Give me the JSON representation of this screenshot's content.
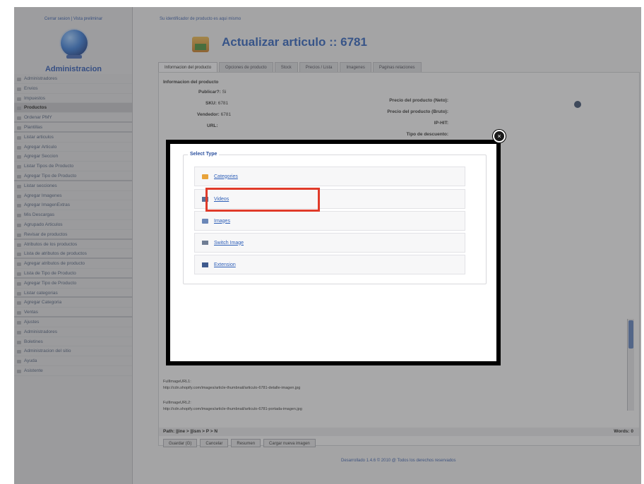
{
  "header": {
    "title": "Actualizar articulo :: 6781",
    "breadcrumb": "Su identificador de producto es aqui mismo"
  },
  "sidebar": {
    "top_links": "Cerrar sesion | Vista preliminar",
    "title": "Administracion",
    "items": [
      {
        "label": "Administradores"
      },
      {
        "label": "Envios"
      },
      {
        "label": "Impuestos"
      },
      {
        "label": "Productos",
        "active": true
      },
      {
        "label": "Ordenar PMY"
      },
      {
        "label": "Plantillas"
      },
      {
        "label": "Listar articulos"
      },
      {
        "label": "Agregar Articulo"
      },
      {
        "label": "Agregar Seccion"
      },
      {
        "label": "Listar Tipos de Producto"
      },
      {
        "label": "Agregar Tipo de Producto"
      },
      {
        "label": "Listar secciones"
      },
      {
        "label": "Agregar Imagenes"
      },
      {
        "label": "Agregar ImagenExtras"
      },
      {
        "label": "Mis Descargas"
      },
      {
        "label": "Agrupado Articulos"
      },
      {
        "label": "Revisar de productos"
      },
      {
        "label": "Atributos de los productos"
      },
      {
        "label": "Lista de atributos de productos"
      },
      {
        "label": "Agregar atributos de producto"
      },
      {
        "label": "Lista de Tipo de Producto"
      },
      {
        "label": "Agregar Tipo de Producto"
      },
      {
        "label": "Listar categorias"
      },
      {
        "label": "Agregar Categoria"
      },
      {
        "label": "Ventas"
      },
      {
        "label": "Ajustes"
      },
      {
        "label": "Administradores"
      },
      {
        "label": "Boletines"
      },
      {
        "label": "Administracion del sitio"
      },
      {
        "label": "Ayuda"
      },
      {
        "label": "Asistente"
      }
    ]
  },
  "tabs": [
    {
      "label": "Informacion del producto",
      "active": true
    },
    {
      "label": "Opciones de producto"
    },
    {
      "label": "Stock"
    },
    {
      "label": "Precios / Lista"
    },
    {
      "label": "Imagenes"
    },
    {
      "label": "Paginas relaciones"
    }
  ],
  "product_info": {
    "section_title": "Informacion del producto",
    "fields": [
      {
        "label": "Publicar?:",
        "value": "Si"
      },
      {
        "label": "SKU:",
        "value": "6781"
      },
      {
        "label": "Vendedor:",
        "value": "6781"
      },
      {
        "label": "URL:",
        "value": ""
      }
    ],
    "right_fields": [
      "Precio del producto (Neto):",
      "Precio del producto (Bruto):",
      "IP-HIT:",
      "Tipo de descuento:"
    ]
  },
  "bottom": {
    "thumb_line1_label": "FullImageURL1:",
    "thumb_line1_value": "http://cdn.shopify.com/images/article-thumbnail/articulo-6781-detalle-imagen.jpg",
    "thumb_line2_label": "FullImageURL2:",
    "thumb_line2_value": "http://cdn.shopify.com/images/article-thumbnail/articulo-6781-portada-imagen.jpg",
    "path_label": "Path: ||ine > ||ism > P > N",
    "words_label": "Words: 0",
    "buttons": [
      "Guardar (G)",
      "Cancelar",
      "Resumen",
      "Cargar nueva imagen"
    ],
    "footer": "Desarrollado 1.4.6 © 2010 @ Todos los derechos reservados"
  },
  "modal": {
    "legend": "Select Type",
    "close_symbol": "×",
    "options": [
      {
        "label": "Categories",
        "icon": "folder-icon"
      },
      {
        "label": "Videos",
        "icon": "video-icon",
        "highlighted": true
      },
      {
        "label": "Images",
        "icon": "image-icon"
      },
      {
        "label": "Switch Image",
        "icon": "switch-image-icon"
      },
      {
        "label": "Extension",
        "icon": "extension-icon"
      }
    ]
  },
  "colors": {
    "highlight": "#e03b2a",
    "link": "#2e5fb8",
    "modal_border": "#000000"
  }
}
